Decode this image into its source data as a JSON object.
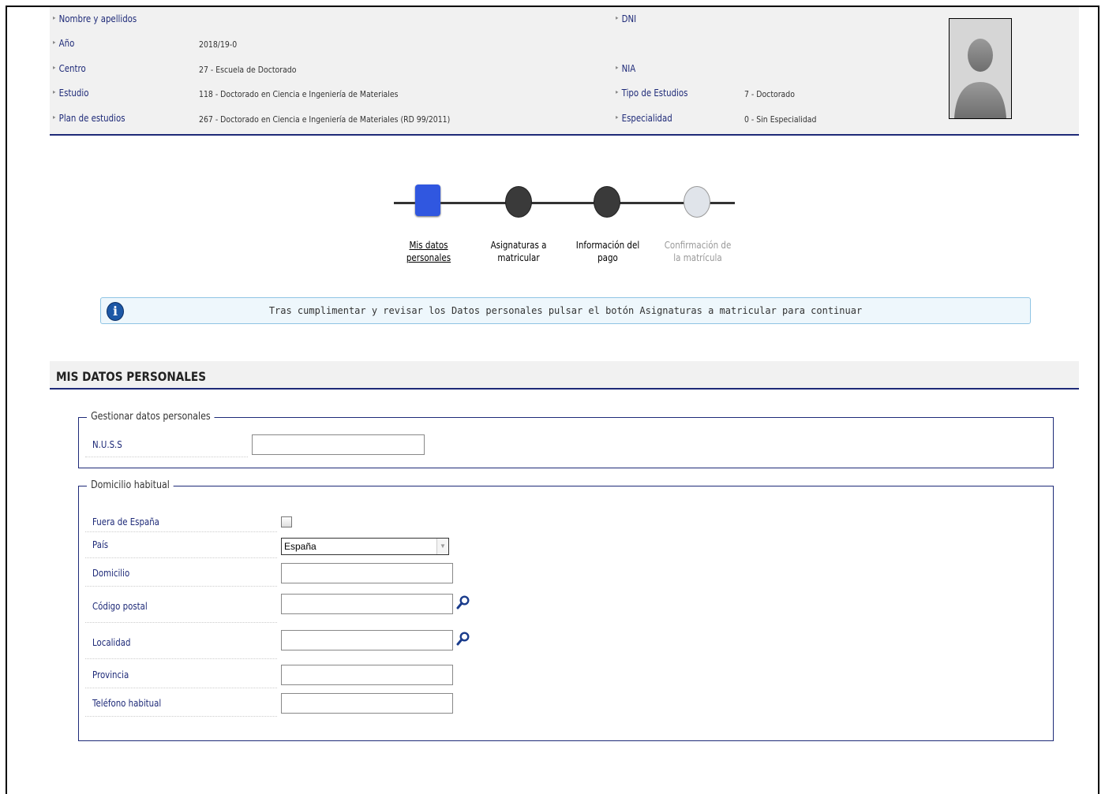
{
  "header": {
    "rows_left": [
      {
        "label": "Nombre y apellidos",
        "value": ""
      },
      {
        "label": "Año",
        "value": "2018/19-0"
      },
      {
        "label": "Centro",
        "value": "27 - Escuela de Doctorado"
      },
      {
        "label": "Estudio",
        "value": "118 - Doctorado en Ciencia e Ingeniería de Materiales"
      },
      {
        "label": "Plan de estudios",
        "value": "267 - Doctorado en Ciencia e Ingeniería de Materiales (RD 99/2011)"
      }
    ],
    "rows_right": [
      {
        "label": "DNI",
        "value": ""
      },
      {
        "label": "NIA",
        "value": ""
      },
      {
        "label": "Tipo de Estudios",
        "value": "7 - Doctorado"
      },
      {
        "label": "Especialidad",
        "value": "0 - Sin Especialidad"
      }
    ]
  },
  "stepper": {
    "steps": [
      {
        "line1": "Mis datos",
        "line2": "personales",
        "state": "current"
      },
      {
        "line1": "Asignaturas a",
        "line2": "matricular",
        "state": "pending"
      },
      {
        "line1": "Información del",
        "line2": "pago",
        "state": "pending"
      },
      {
        "line1": "Confirmación de",
        "line2": "la matrícula",
        "state": "disabled"
      }
    ],
    "colors": {
      "current": "#3057e0",
      "pending": "#3a3a3a",
      "disabled": "#e0e4ea"
    }
  },
  "info_message": {
    "text": "Tras cumplimentar y revisar los Datos personales pulsar el botón Asignaturas a matricular para continuar"
  },
  "section_title": "MIS DATOS PERSONALES",
  "gestionar": {
    "legend": "Gestionar datos personales",
    "nuss_label": "N.U.S.S",
    "nuss_value": ""
  },
  "domicilio": {
    "legend": "Domicilio habitual",
    "fuera_label": "Fuera de España",
    "fuera_checked": false,
    "pais_label": "País",
    "pais_value": "España",
    "domicilio_label": "Domicilio",
    "domicilio_value": "",
    "cp_label": "Código postal",
    "cp_value": "",
    "localidad_label": "Localidad",
    "localidad_value": "",
    "provincia_label": "Provincia",
    "provincia_value": "",
    "telefono_label": "Teléfono habitual",
    "telefono_value": ""
  },
  "colors": {
    "accent": "#1e2a78",
    "info_border": "#8fc4e4",
    "info_bg": "#eef7fc",
    "info_icon": "#1d58a6"
  }
}
